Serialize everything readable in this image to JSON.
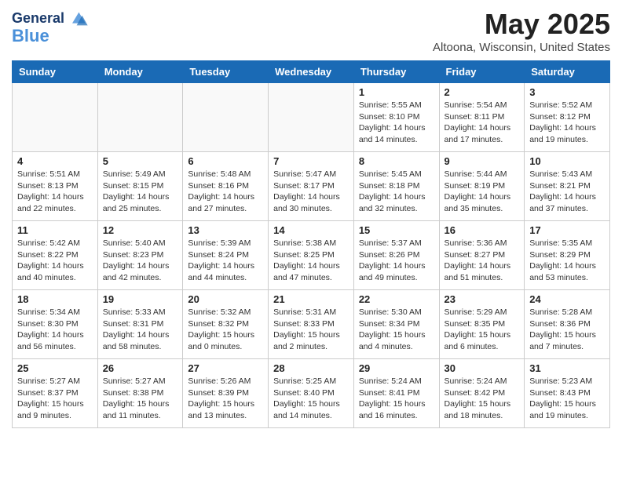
{
  "header": {
    "logo_line1": "General",
    "logo_line2": "Blue",
    "title": "May 2025",
    "subtitle": "Altoona, Wisconsin, United States"
  },
  "weekdays": [
    "Sunday",
    "Monday",
    "Tuesday",
    "Wednesday",
    "Thursday",
    "Friday",
    "Saturday"
  ],
  "weeks": [
    [
      {
        "day": "",
        "info": ""
      },
      {
        "day": "",
        "info": ""
      },
      {
        "day": "",
        "info": ""
      },
      {
        "day": "",
        "info": ""
      },
      {
        "day": "1",
        "info": "Sunrise: 5:55 AM\nSunset: 8:10 PM\nDaylight: 14 hours\nand 14 minutes."
      },
      {
        "day": "2",
        "info": "Sunrise: 5:54 AM\nSunset: 8:11 PM\nDaylight: 14 hours\nand 17 minutes."
      },
      {
        "day": "3",
        "info": "Sunrise: 5:52 AM\nSunset: 8:12 PM\nDaylight: 14 hours\nand 19 minutes."
      }
    ],
    [
      {
        "day": "4",
        "info": "Sunrise: 5:51 AM\nSunset: 8:13 PM\nDaylight: 14 hours\nand 22 minutes."
      },
      {
        "day": "5",
        "info": "Sunrise: 5:49 AM\nSunset: 8:15 PM\nDaylight: 14 hours\nand 25 minutes."
      },
      {
        "day": "6",
        "info": "Sunrise: 5:48 AM\nSunset: 8:16 PM\nDaylight: 14 hours\nand 27 minutes."
      },
      {
        "day": "7",
        "info": "Sunrise: 5:47 AM\nSunset: 8:17 PM\nDaylight: 14 hours\nand 30 minutes."
      },
      {
        "day": "8",
        "info": "Sunrise: 5:45 AM\nSunset: 8:18 PM\nDaylight: 14 hours\nand 32 minutes."
      },
      {
        "day": "9",
        "info": "Sunrise: 5:44 AM\nSunset: 8:19 PM\nDaylight: 14 hours\nand 35 minutes."
      },
      {
        "day": "10",
        "info": "Sunrise: 5:43 AM\nSunset: 8:21 PM\nDaylight: 14 hours\nand 37 minutes."
      }
    ],
    [
      {
        "day": "11",
        "info": "Sunrise: 5:42 AM\nSunset: 8:22 PM\nDaylight: 14 hours\nand 40 minutes."
      },
      {
        "day": "12",
        "info": "Sunrise: 5:40 AM\nSunset: 8:23 PM\nDaylight: 14 hours\nand 42 minutes."
      },
      {
        "day": "13",
        "info": "Sunrise: 5:39 AM\nSunset: 8:24 PM\nDaylight: 14 hours\nand 44 minutes."
      },
      {
        "day": "14",
        "info": "Sunrise: 5:38 AM\nSunset: 8:25 PM\nDaylight: 14 hours\nand 47 minutes."
      },
      {
        "day": "15",
        "info": "Sunrise: 5:37 AM\nSunset: 8:26 PM\nDaylight: 14 hours\nand 49 minutes."
      },
      {
        "day": "16",
        "info": "Sunrise: 5:36 AM\nSunset: 8:27 PM\nDaylight: 14 hours\nand 51 minutes."
      },
      {
        "day": "17",
        "info": "Sunrise: 5:35 AM\nSunset: 8:29 PM\nDaylight: 14 hours\nand 53 minutes."
      }
    ],
    [
      {
        "day": "18",
        "info": "Sunrise: 5:34 AM\nSunset: 8:30 PM\nDaylight: 14 hours\nand 56 minutes."
      },
      {
        "day": "19",
        "info": "Sunrise: 5:33 AM\nSunset: 8:31 PM\nDaylight: 14 hours\nand 58 minutes."
      },
      {
        "day": "20",
        "info": "Sunrise: 5:32 AM\nSunset: 8:32 PM\nDaylight: 15 hours\nand 0 minutes."
      },
      {
        "day": "21",
        "info": "Sunrise: 5:31 AM\nSunset: 8:33 PM\nDaylight: 15 hours\nand 2 minutes."
      },
      {
        "day": "22",
        "info": "Sunrise: 5:30 AM\nSunset: 8:34 PM\nDaylight: 15 hours\nand 4 minutes."
      },
      {
        "day": "23",
        "info": "Sunrise: 5:29 AM\nSunset: 8:35 PM\nDaylight: 15 hours\nand 6 minutes."
      },
      {
        "day": "24",
        "info": "Sunrise: 5:28 AM\nSunset: 8:36 PM\nDaylight: 15 hours\nand 7 minutes."
      }
    ],
    [
      {
        "day": "25",
        "info": "Sunrise: 5:27 AM\nSunset: 8:37 PM\nDaylight: 15 hours\nand 9 minutes."
      },
      {
        "day": "26",
        "info": "Sunrise: 5:27 AM\nSunset: 8:38 PM\nDaylight: 15 hours\nand 11 minutes."
      },
      {
        "day": "27",
        "info": "Sunrise: 5:26 AM\nSunset: 8:39 PM\nDaylight: 15 hours\nand 13 minutes."
      },
      {
        "day": "28",
        "info": "Sunrise: 5:25 AM\nSunset: 8:40 PM\nDaylight: 15 hours\nand 14 minutes."
      },
      {
        "day": "29",
        "info": "Sunrise: 5:24 AM\nSunset: 8:41 PM\nDaylight: 15 hours\nand 16 minutes."
      },
      {
        "day": "30",
        "info": "Sunrise: 5:24 AM\nSunset: 8:42 PM\nDaylight: 15 hours\nand 18 minutes."
      },
      {
        "day": "31",
        "info": "Sunrise: 5:23 AM\nSunset: 8:43 PM\nDaylight: 15 hours\nand 19 minutes."
      }
    ]
  ]
}
